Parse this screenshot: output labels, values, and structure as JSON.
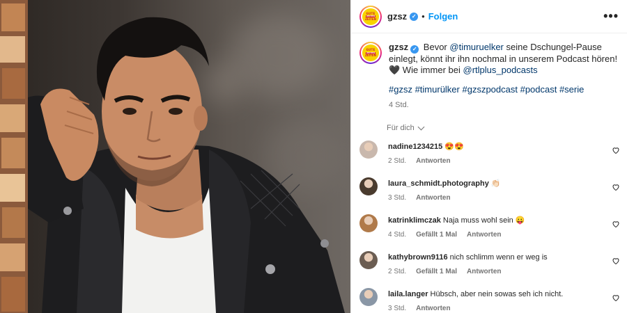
{
  "post": {
    "username": "gzsz",
    "follow_label": "Folgen",
    "dot": "•",
    "more_label": "•••",
    "logo": {
      "line1": "GUTE",
      "line2": "ZEITEN",
      "line3": "ZEITEN"
    },
    "caption": {
      "username": "gzsz",
      "text_before": "Bevor",
      "mention1": "@timuruelker",
      "text_mid": "seine Dschungel-Pause einlegt, könnt ihr ihn nochmal in unserem Podcast hören! 🖤 Wie immer bei",
      "mention2": "@rtlplus_podcasts",
      "hashtags": "#gzsz #timurülker #gzszpodcast #podcast #serie",
      "age": "4 Std."
    },
    "for_you_label": "Für dich",
    "colors": {
      "link": "#00376b",
      "follow": "#0095f6",
      "verified": "#3897f0"
    }
  },
  "comments": [
    {
      "user": "nadine1234215",
      "text": "😍😍",
      "age": "2 Std.",
      "likes": "",
      "reply": "Antworten",
      "avatar_color": "#c9b8ad"
    },
    {
      "user": "laura_schmidt.photography",
      "text": "👏🏻",
      "age": "3 Std.",
      "likes": "",
      "reply": "Antworten",
      "avatar_color": "#4a3b2e"
    },
    {
      "user": "katrinklimczak",
      "text": "Naja muss wohl sein 😛",
      "age": "4 Std.",
      "likes": "Gefällt 1 Mal",
      "reply": "Antworten",
      "avatar_color": "#b07a4a"
    },
    {
      "user": "kathybrown9116",
      "text": "nich schlimm wenn er weg is",
      "age": "2 Std.",
      "likes": "Gefällt 1 Mal",
      "reply": "Antworten",
      "avatar_color": "#6b5d52"
    },
    {
      "user": "laila.langer",
      "text": "Hübsch, aber nein sowas seh ich nicht.",
      "age": "3 Std.",
      "likes": "",
      "reply": "Antworten",
      "avatar_color": "#8a97a6"
    }
  ],
  "icons": {
    "verified": "verified-badge-icon",
    "more": "more-options-icon",
    "chevron": "chevron-down-icon",
    "heart": "heart-icon"
  }
}
